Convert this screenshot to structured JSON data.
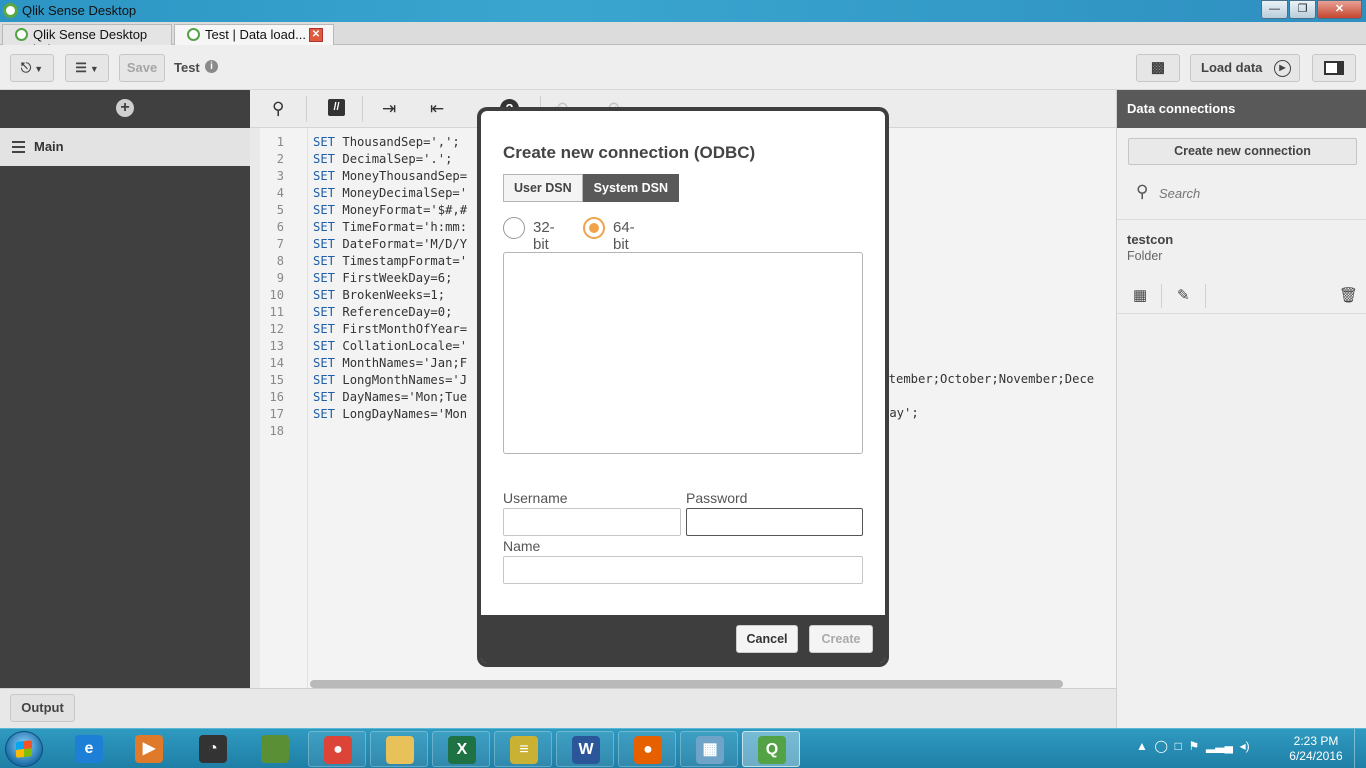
{
  "window": {
    "title": "Qlik Sense Desktop"
  },
  "tabs": [
    {
      "label": "Qlik Sense Desktop hub"
    },
    {
      "label": "Test | Data load..."
    }
  ],
  "toolbar": {
    "save_label": "Save",
    "app_name": "Test",
    "load_data_label": "Load data"
  },
  "sections": {
    "main_label": "Main"
  },
  "editor": {
    "lines": [
      {
        "n": "1",
        "kw": "SET",
        "text": " ThousandSep=',';"
      },
      {
        "n": "2",
        "kw": "SET",
        "text": " DecimalSep='.';"
      },
      {
        "n": "3",
        "kw": "SET",
        "text": " MoneyThousandSep="
      },
      {
        "n": "4",
        "kw": "SET",
        "text": " MoneyDecimalSep='"
      },
      {
        "n": "5",
        "kw": "SET",
        "text": " MoneyFormat='$#,#"
      },
      {
        "n": "6",
        "kw": "SET",
        "text": " TimeFormat='h:mm:"
      },
      {
        "n": "7",
        "kw": "SET",
        "text": " DateFormat='M/D/Y"
      },
      {
        "n": "8",
        "kw": "SET",
        "text": " TimestampFormat='"
      },
      {
        "n": "9",
        "kw": "SET",
        "text": " FirstWeekDay=6;"
      },
      {
        "n": "10",
        "kw": "SET",
        "text": " BrokenWeeks=1;"
      },
      {
        "n": "11",
        "kw": "SET",
        "text": " ReferenceDay=0;"
      },
      {
        "n": "12",
        "kw": "SET",
        "text": " FirstMonthOfYear="
      },
      {
        "n": "13",
        "kw": "SET",
        "text": " CollationLocale='"
      },
      {
        "n": "14",
        "kw": "SET",
        "text": " MonthNames='Jan;F"
      },
      {
        "n": "15",
        "kw": "SET",
        "text": " LongMonthNames='J"
      },
      {
        "n": "16",
        "kw": "SET",
        "text": " DayNames='Mon;Tue"
      },
      {
        "n": "17",
        "kw": "SET",
        "text": " LongDayNames='Mon"
      },
      {
        "n": "18",
        "kw": "",
        "text": ""
      }
    ],
    "overflow_line15": "eptember;October;November;Dece",
    "overflow_line17": "day';"
  },
  "output_label": "Output",
  "data_connections": {
    "header": "Data connections",
    "create_label": "Create new connection",
    "search_placeholder": "Search",
    "connection": {
      "name": "testcon",
      "type": "Folder"
    }
  },
  "modal": {
    "title": "Create new connection (ODBC)",
    "dsn_tabs": [
      "User DSN",
      "System DSN"
    ],
    "selected_dsn_tab": "System DSN",
    "bitness": [
      "32-bit",
      "64-bit"
    ],
    "selected_bitness": "64-bit",
    "username_label": "Username",
    "password_label": "Password",
    "name_label": "Name",
    "username_value": "",
    "password_value": "",
    "name_value": "",
    "cancel_label": "Cancel",
    "create_label": "Create"
  },
  "taskbar": {
    "clock_time": "2:23 PM",
    "clock_date": "6/24/2016",
    "apps": [
      "internet-explorer",
      "media-player",
      "speed-tool",
      "minecraft",
      "chrome",
      "file-explorer",
      "excel",
      "system-monitor",
      "word",
      "firefox",
      "remote-desktop",
      "qlik-sense"
    ]
  },
  "colors": {
    "accent_orange": "#f0a34a",
    "qlik_green": "#54a246",
    "dark_panel": "#404040"
  }
}
